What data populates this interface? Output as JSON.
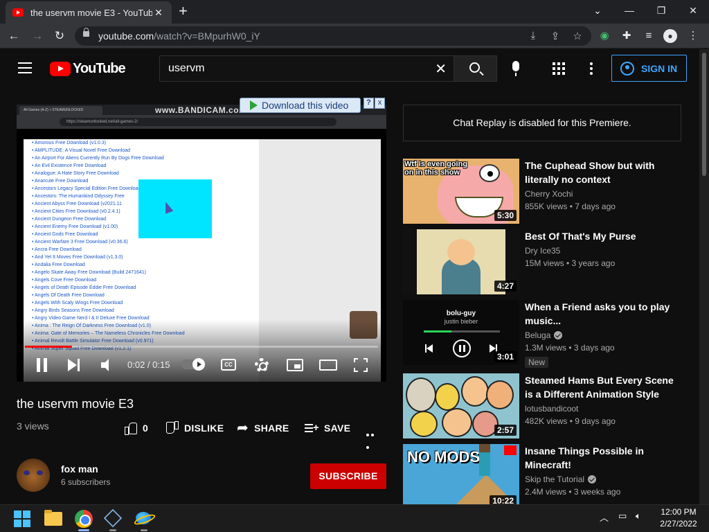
{
  "browser": {
    "tab_title": "the uservm movie E3 - YouTube",
    "url_host": "youtube.com",
    "url_path": "/watch?v=BMpurhW0_iY"
  },
  "header": {
    "logo_text": "YouTube",
    "search_query": "uservm",
    "sign_in_label": "SIGN IN"
  },
  "player": {
    "overlay_download_label": "Download this video",
    "overlay_help": "?",
    "overlay_close": "x",
    "recorder_watermark": "www.BANDICAM.com",
    "inner_tab_title": "All Games (A-Z) » STEAMUNLOCKED",
    "inner_url": "https://steamunlocked.net/all-games-2/",
    "inner_list": [
      "Amorous Free Download (v1.0.3)",
      "AMPLITUDE: A Visual Novel Free Download",
      "An Airport For Aliens Currently Run By Dogs Free Download",
      "An Evil Existence Free Download",
      "Analogue: A Hate Story Free Download",
      "Anarcute Free Download",
      "Ancestors Legacy Special Edition Free Download",
      "Ancestors: The Humankind Odyssey Free",
      "Ancient Abyss Free Download (v2021.11",
      "Ancient Cities Free Download (v0.2.4.1)",
      "Ancient Dungeon Free Download",
      "Ancient Enemy Free Download (v1.00)",
      "Ancient Gods Free Download",
      "Ancient Warfare 3 Free Download (v0.36.6)",
      "Ancra Free Download",
      "And Yet It Moves Free Download (v1.3.0)",
      "Andalia Free Download",
      "Angelo Skate Away Free Download (Build 2471641)",
      "Angels Cove Free Download",
      "Angels of Death Episode Eddie Free Download",
      "Angels Of Death Free Download",
      "Angels With Scaly Wings Free Download",
      "Angry Birds Seasons Free Download",
      "Angry Video Game Nerd I & II Deluxe Free Download",
      "Anima : The Reign Of Darkness Free Download (v1.0)",
      "Anima: Gate of Memories – The Nameless Chronicles Free Download",
      "Animal Revolt Battle Simulator Free Download (v0.971)",
      "Animal Super Squad Free Download (v1.2.1)"
    ],
    "time_current": "0:02",
    "time_total": "0:15",
    "progress_fraction": 0.133,
    "cc_label": "CC"
  },
  "video": {
    "title": "the uservm movie E3",
    "views": "3 views",
    "like_count": "0",
    "dislike_label": "DISLIKE",
    "share_label": "SHARE",
    "save_label": "SAVE"
  },
  "channel": {
    "name": "fox man",
    "subscribers": "6 subscribers",
    "subscribe_label": "SUBSCRIBE"
  },
  "sidebar": {
    "chat_replay_message": "Chat Replay is disabled for this Premiere.",
    "recommendations": [
      {
        "title": "The Cuphead Show but with literally no context",
        "channel": "Cherry Xochi",
        "meta": "855K views • 7 days ago",
        "duration": "5:30",
        "thumb_caption": "Wtf is even going on in this show"
      },
      {
        "title": "Best Of That's My Purse",
        "channel": "Dry Ice35",
        "meta": "15M views • 3 years ago",
        "duration": "4:27"
      },
      {
        "title": "When a Friend asks you to play music...",
        "channel": "Beluga",
        "meta": "1.3M views • 3 days ago",
        "duration": "3:01",
        "badge": "New",
        "thumb_song": "bolu-guy",
        "thumb_artist": "justin bieber"
      },
      {
        "title": "Steamed Hams But Every Scene is a Different Animation Style",
        "channel": "lotusbandicoot",
        "meta": "482K views • 9 days ago",
        "duration": "2:57"
      },
      {
        "title": "Insane Things Possible in Minecraft!",
        "channel": "Skip the Tutorial",
        "meta": "2.4M views • 3 weeks ago",
        "duration": "10:22",
        "thumb_caption": "NO MODS"
      }
    ]
  },
  "taskbar": {
    "time": "12:00 PM",
    "date": "2/27/2022"
  },
  "colors": {
    "youtube_red": "#ff0000",
    "subscribe_red": "#cc0000",
    "link_blue": "#3ea6ff",
    "background": "#0f0f0f"
  }
}
